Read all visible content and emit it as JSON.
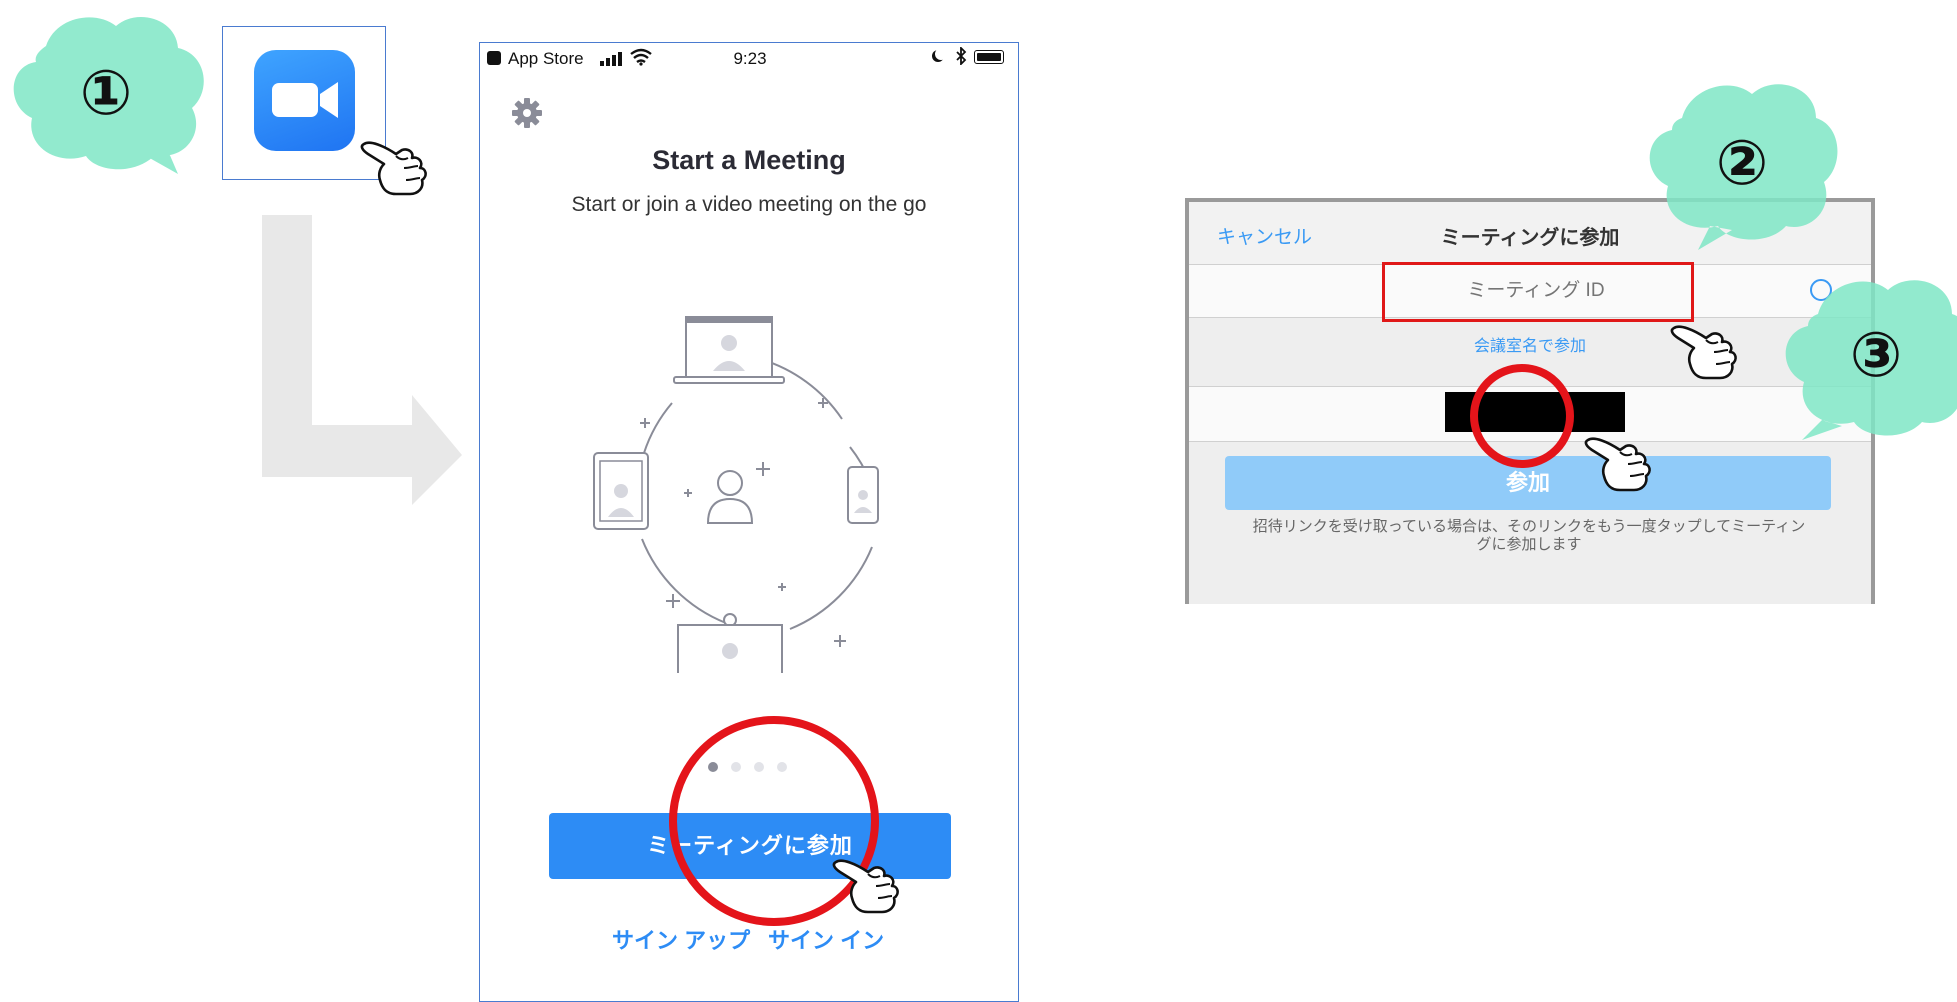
{
  "steps": {
    "step1": "①",
    "step2": "②",
    "step3": "③"
  },
  "colors": {
    "accent": "#2d8cf5",
    "highlight": "#e4141a",
    "bubble": "#7fe6c6"
  },
  "phone": {
    "status": {
      "back_label": "App Store",
      "time": "9:23"
    },
    "title": "Start a Meeting",
    "subtitle": "Start or join a video meeting on the go",
    "join_button": "ミーティングに参加",
    "signup_link": "サイン アップ",
    "signin_link": "サイン イン",
    "page_dots": {
      "count": 4,
      "active": 1
    }
  },
  "dialog": {
    "cancel": "キャンセル",
    "title": "ミーティングに参加",
    "meeting_id_placeholder": "ミーティング ID",
    "room_name_link": "会議室名で参加",
    "join_button": "参加",
    "note_line1": "招待リンクを受け取っている場合は、そのリンクをもう一度タップしてミーティン",
    "note_line2": "グに参加します"
  },
  "icons": [
    "zoom-app-icon",
    "gear-icon",
    "pointing-hand-icon",
    "arrow-icon",
    "clear-icon"
  ]
}
